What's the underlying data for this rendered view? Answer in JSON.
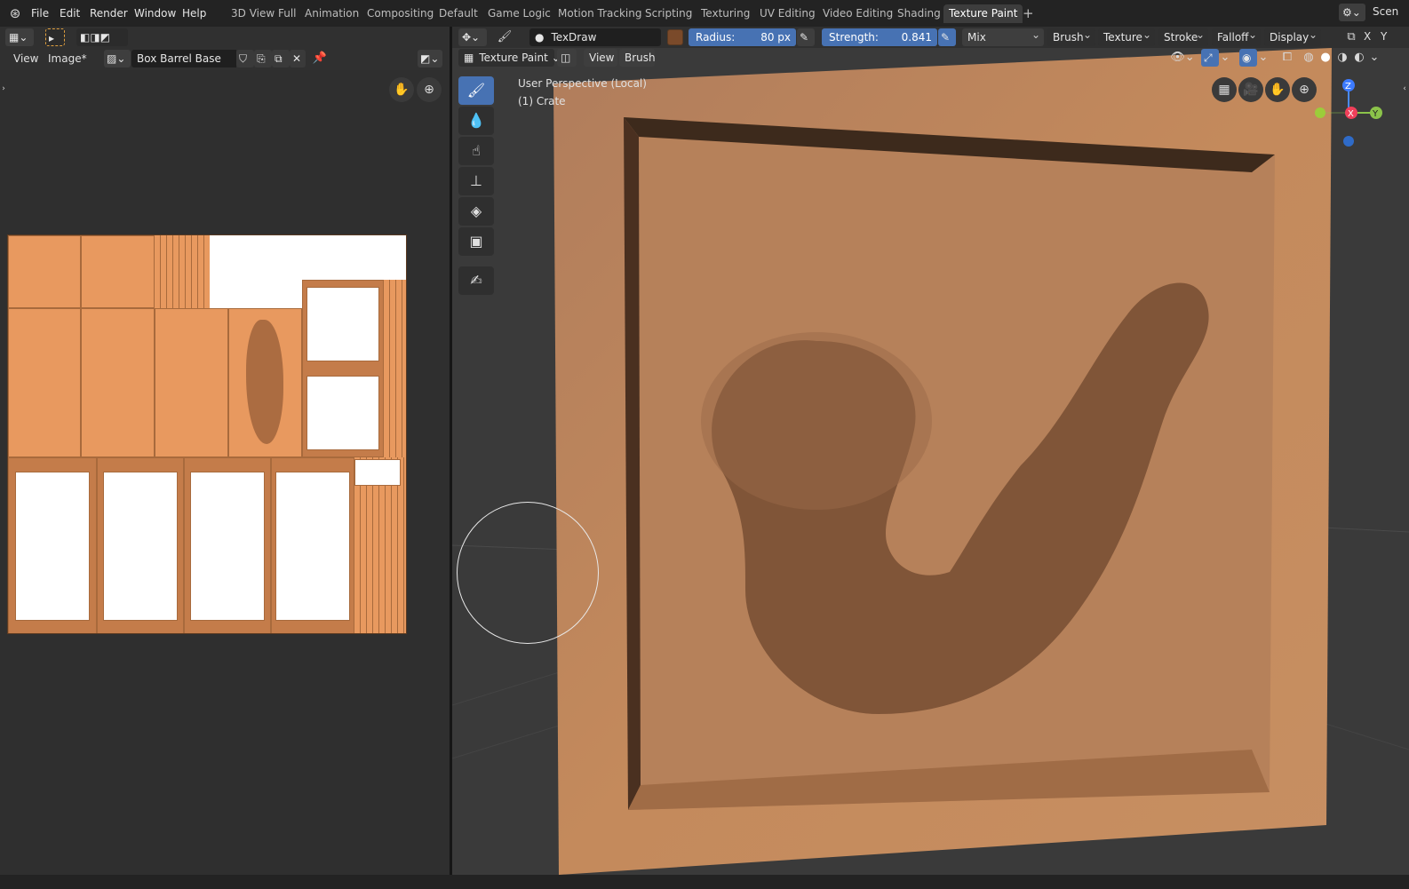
{
  "menu": {
    "file": "File",
    "edit": "Edit",
    "render": "Render",
    "window": "Window",
    "help": "Help"
  },
  "workspaces": [
    "3D View Full",
    "Animation",
    "Compositing",
    "Default",
    "Game Logic",
    "Motion Tracking",
    "Scripting",
    "Texturing",
    "UV Editing",
    "Video Editing",
    "Shading",
    "Texture Paint"
  ],
  "active_workspace": "Texture Paint",
  "add_tab": "+",
  "scene_label": "Scen",
  "image_editor": {
    "view_menu": "View",
    "image_menu": "Image*",
    "image_name": "Box Barrel Base"
  },
  "viewport": {
    "mode": "Texture Paint",
    "view_menu": "View",
    "brush_menu": "Brush",
    "brush_name": "TexDraw",
    "radius_label": "Radius:",
    "radius_value": "80 px",
    "strength_label": "Strength:",
    "strength_value": "0.841",
    "blend": "Mix",
    "dropdowns": {
      "brush": "Brush",
      "texture": "Texture",
      "stroke": "Stroke",
      "falloff": "Falloff",
      "display": "Display"
    },
    "axis_x": "X",
    "axis_y": "Y",
    "perspective": "User Perspective (Local)",
    "object": "(1) Crate",
    "gizmo": {
      "z": "Z",
      "x": "X",
      "y": "Y"
    },
    "brush_color": "#7a4a2a",
    "accent": "#4772b3"
  },
  "colors": {
    "wood": "#c98a5a",
    "wood_dark": "#8a5a38",
    "paint_stroke": "#7a5034"
  }
}
